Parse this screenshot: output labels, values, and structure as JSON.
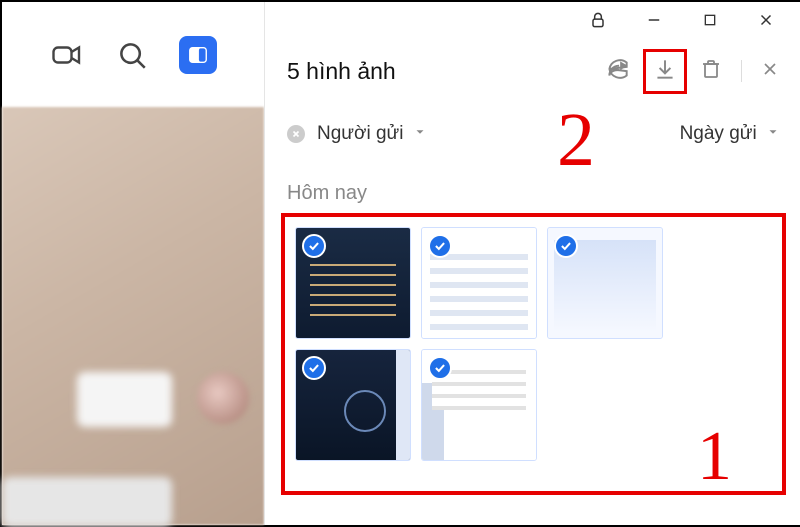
{
  "toolbar": {
    "video_icon": "video-icon",
    "search_icon": "search-icon",
    "toggle_icon": "panel-toggle-icon"
  },
  "header": {
    "title": "5 hình ảnh",
    "share_icon": "share-icon",
    "download_icon": "download-icon",
    "delete_icon": "trash-icon",
    "close_icon": "close-icon"
  },
  "titlebar": {
    "lock_icon": "lock-icon",
    "minimize": "−",
    "maximize": "□",
    "close": "×"
  },
  "filters": {
    "sender_label": "Người gửi",
    "date_label": "Ngày gửi"
  },
  "section": {
    "today_label": "Hôm nay"
  },
  "thumbs": [
    {
      "selected": true
    },
    {
      "selected": true
    },
    {
      "selected": true
    },
    {
      "selected": true
    },
    {
      "selected": true
    }
  ],
  "annotations": {
    "step1": "1",
    "step2": "2"
  }
}
